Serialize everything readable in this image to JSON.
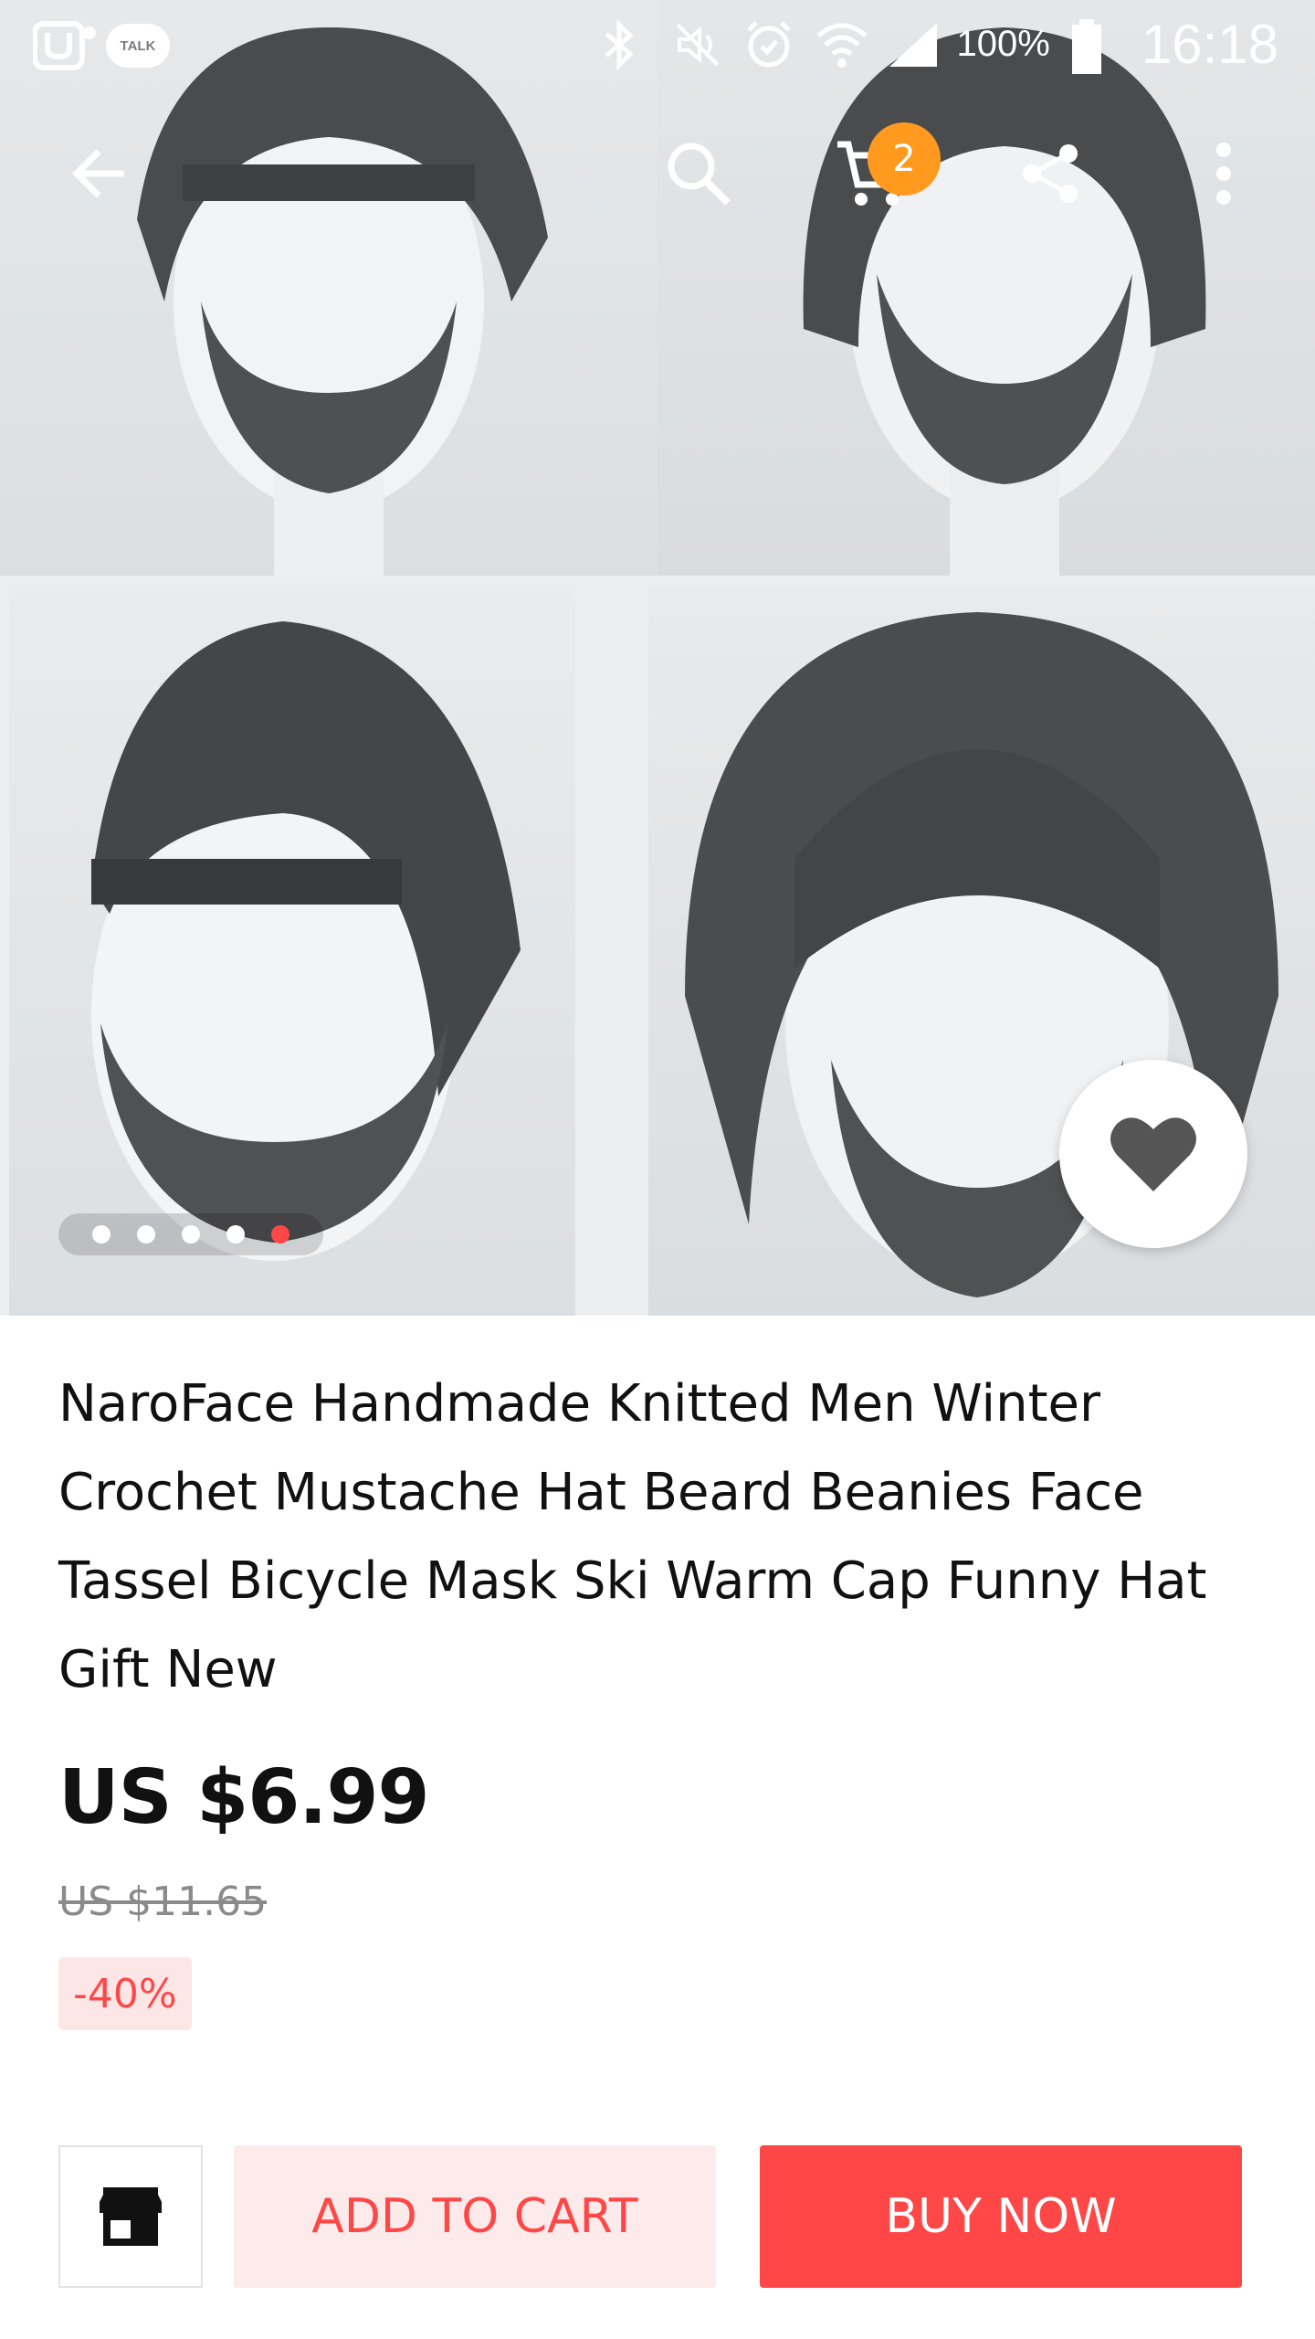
{
  "status_bar": {
    "talk_label": "TALK",
    "battery": "100%",
    "time": "16:18"
  },
  "toolbar": {
    "cart_count": "2"
  },
  "carousel": {
    "dots": 5,
    "active_index": 4
  },
  "product": {
    "title": "NaroFace Handmade Knitted Men Winter Crochet Mustache Hat Beard Beanies Face Tassel Bicycle Mask Ski Warm Cap Funny Hat Gift New",
    "price": "US $6.99",
    "original_price": "US $11.65",
    "discount": "-40%"
  },
  "actions": {
    "add_to_cart": "ADD TO CART",
    "buy_now": "BUY NOW"
  },
  "colors": {
    "accent": "#ff4747",
    "badge": "#ff9a1e",
    "add_to_cart_bg": "#fdeaea"
  }
}
